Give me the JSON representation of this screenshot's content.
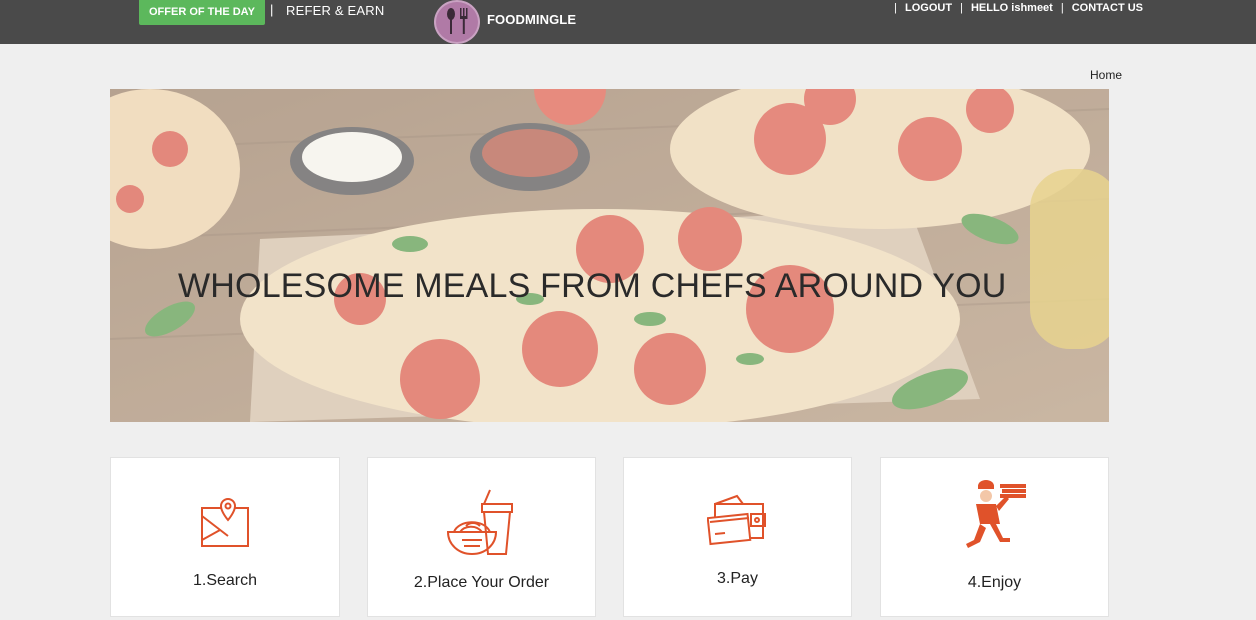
{
  "topbar": {
    "offer_label": "OFFER OF THE DAY",
    "separator": "|",
    "refer_label": "REFER & EARN",
    "brand": "FOODMINGLE",
    "right_nav": {
      "logout": "LOGOUT",
      "greeting": "HELLO ishmeet",
      "contact": "CONTACT US"
    }
  },
  "breadcrumb": {
    "home": "Home"
  },
  "hero": {
    "title": "WHOLESOME MEALS FROM CHEFS AROUND YOU"
  },
  "steps": [
    {
      "label": "1.Search",
      "icon": "map-pin-icon"
    },
    {
      "label": "2.Place Your Order",
      "icon": "food-drink-icon"
    },
    {
      "label": "3.Pay",
      "icon": "wallet-card-icon"
    },
    {
      "label": "4.Enjoy",
      "icon": "delivery-person-icon"
    }
  ],
  "colors": {
    "topbar": "#4a4a4a",
    "offer_button": "#5cb85c",
    "accent_icon": "#e0522a",
    "page_bg": "#efefef"
  }
}
